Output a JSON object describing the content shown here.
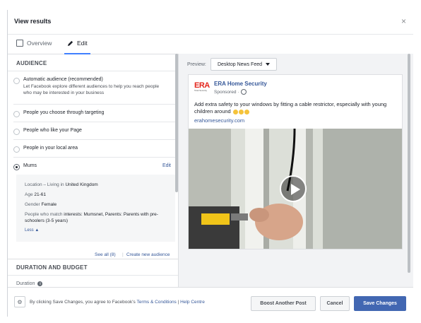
{
  "modal": {
    "title": "View results",
    "close_glyph": "×"
  },
  "tabs": [
    {
      "label": "Overview",
      "icon": "overview-icon"
    },
    {
      "label": "Edit",
      "icon": "pencil-icon",
      "active": true
    }
  ],
  "audience": {
    "header": "AUDIENCE",
    "options": [
      {
        "label": "Automatic audience (recommended)",
        "description": "Let Facebook explore different audiences to help you reach people who may be interested in your business",
        "selected": false
      },
      {
        "label": "People you choose through targeting",
        "selected": false
      },
      {
        "label": "People who like your Page",
        "selected": false
      },
      {
        "label": "People in your local area",
        "selected": false
      },
      {
        "label": "Mums",
        "selected": true
      }
    ],
    "edit_label": "Edit",
    "details": {
      "location_prefix": "Location – Living in ",
      "location_value": "United Kingdom",
      "age_prefix": "Age ",
      "age_value": "21-61",
      "gender_prefix": "Gender ",
      "gender_value": "Female",
      "interests_prefix": "People who match ",
      "interests_value": "interests: Mumsnet, Parents: Parents with pre-schoolers (3-5 years)",
      "less_label": "Less ▲"
    },
    "see_all": "See all (8)",
    "create_new": "Create new audience"
  },
  "duration_budget": {
    "header": "DURATION AND BUDGET",
    "duration_label": "Duration"
  },
  "preview": {
    "label": "Preview:",
    "placement": "Desktop News Feed",
    "post": {
      "logo_text": "ERA",
      "logo_subtext": "Total Security",
      "page_name": "ERA Home Security",
      "sponsored": "Sponsored ·",
      "text": "Add extra safety to your windows by fitting a cable restrictor, especially with young children around",
      "link": "erahomesecurity.com"
    }
  },
  "footer": {
    "terms_prefix": "By clicking Save Changes, you agree to Facebook's",
    "terms_link": "Terms & Conditions",
    "separator": "|",
    "help_link": "Help Centre",
    "boost_label": "Boost Another Post",
    "cancel_label": "Cancel",
    "save_label": "Save Changes"
  },
  "colors": {
    "primary": "#4267b2",
    "link": "#365899",
    "tab_underline": "#4080ff",
    "brand_red": "#e3241b"
  }
}
